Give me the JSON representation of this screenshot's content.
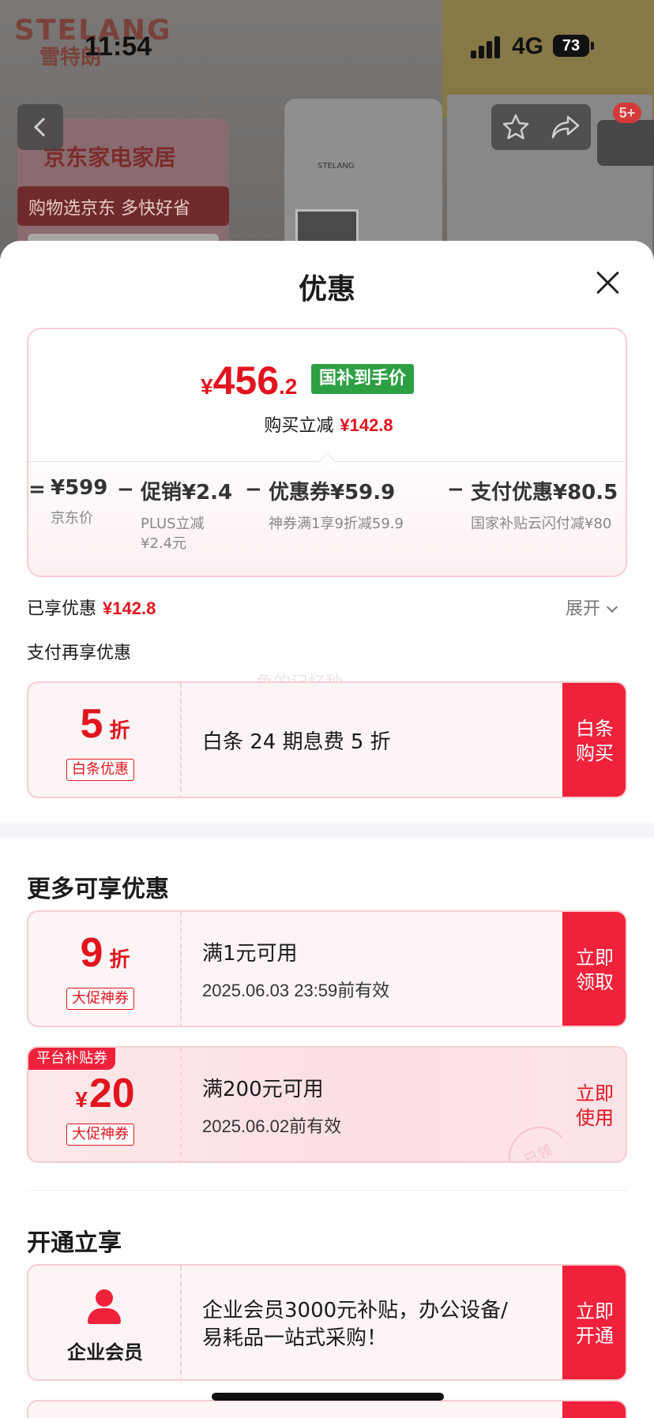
{
  "background": {
    "brand_en": "STELANG",
    "brand_cn": "雪特朗",
    "machine_brand": "STELANG",
    "jd_title": "京东家电家居",
    "jd_sub": "购物选京东 多快好省",
    "cart_badge": "5+"
  },
  "status_bar": {
    "time": "11:54",
    "network": "4G",
    "battery": "73"
  },
  "sheet": {
    "title": "优惠",
    "price": {
      "yen": "¥",
      "integer": "456",
      "decimal": ".2",
      "tag": "国补到手价",
      "reduce_label": "购买立减",
      "reduce_amount": "¥142.8"
    },
    "breakdown": [
      {
        "op": "=",
        "value": "¥599",
        "sub": "京东价"
      },
      {
        "op": "−",
        "value": "促销¥2.4",
        "sub": "PLUS立减",
        "sub2": "¥2.4元"
      },
      {
        "op": "−",
        "value": "优惠券¥59.9",
        "sub": "神券满1享9折减59.9"
      },
      {
        "op": "−",
        "value": "支付优惠¥80.5",
        "sub": "国家补贴云闪付减¥80"
      }
    ],
    "enjoyed_label": "已享优惠",
    "enjoyed_amount": "¥142.8",
    "expand_label": "展开",
    "pay_again_label": "支付再享优惠",
    "watermark": "鱼的记忆秒",
    "baitiao_coupon": {
      "num": "5",
      "unit": "折",
      "tag": "白条优惠",
      "desc": "白条 24 期息费 5 折",
      "button": "白条\n购买"
    },
    "more_title": "更多可享优惠",
    "coupon_9": {
      "num": "9",
      "unit": "折",
      "tag": "大促神券",
      "line1": "满1元可用",
      "line2": "2025.06.03 23:59前有效",
      "button": "立即\n领取"
    },
    "coupon_20": {
      "corner_tag": "平台补贴券",
      "yen": "¥",
      "num": "20",
      "tag": "大促神券",
      "line1": "满200元可用",
      "line2": "2025.06.02前有效",
      "button": "立即\n使用",
      "stamp": "已领"
    },
    "open_title": "开通立享",
    "enterprise": {
      "label": "企业会员",
      "desc": "企业会员3000元补贴，办公设备/易耗品一站式采购！",
      "button": "立即\n开通"
    }
  },
  "colors": {
    "accent_red": "#e1151f",
    "button_red": "#f0213a",
    "guobu_green": "#2ea044"
  }
}
